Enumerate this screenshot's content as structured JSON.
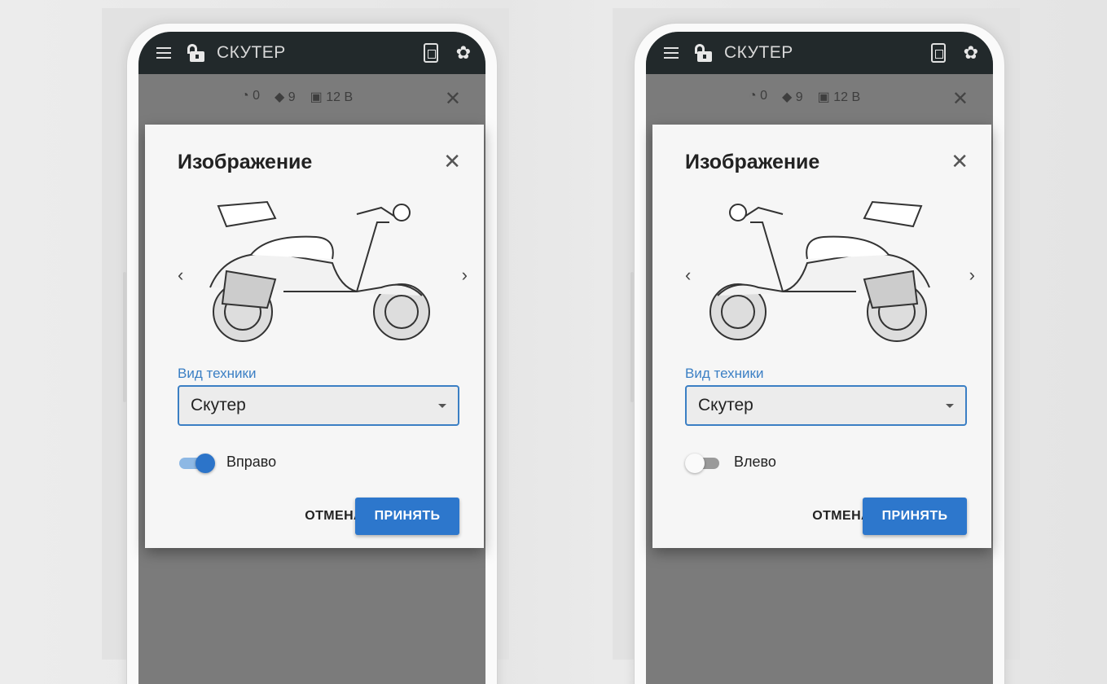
{
  "screens": [
    {
      "appbar": {
        "title": "СКУТЕР"
      },
      "status": {
        "counter": "0",
        "signal": "9",
        "voltage": "12 В"
      },
      "dialog": {
        "title": "Изображение",
        "field_label": "Вид техники",
        "field_value": "Скутер",
        "toggle_label": "Вправо",
        "toggle_on": true,
        "cancel_label": "ОТМЕНА",
        "accept_label": "ПРИНЯТЬ"
      }
    },
    {
      "appbar": {
        "title": "СКУТЕР"
      },
      "status": {
        "counter": "0",
        "signal": "9",
        "voltage": "12 В"
      },
      "dialog": {
        "title": "Изображение",
        "field_label": "Вид техники",
        "field_value": "Скутер",
        "toggle_label": "Влево",
        "toggle_on": false,
        "cancel_label": "ОТМЕНА",
        "accept_label": "ПРИНЯТЬ"
      }
    }
  ],
  "colors": {
    "accent": "#2d77cc",
    "appbar": "#22292b",
    "overlay": "#7b7b7b"
  }
}
